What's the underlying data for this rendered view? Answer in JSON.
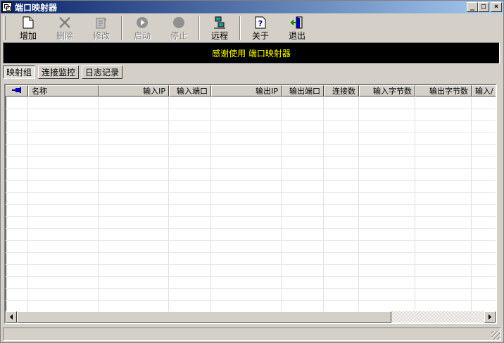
{
  "window": {
    "title": "端口映射器"
  },
  "title_buttons": {
    "minimize": "_",
    "maximize": "□",
    "close": "×"
  },
  "toolbar": {
    "add": "增加",
    "delete": "删除",
    "modify": "修改",
    "start": "启动",
    "stop": "停止",
    "remote": "远程",
    "about": "关于",
    "exit": "退出"
  },
  "banner": {
    "text": "感谢使用 端口映射器"
  },
  "tabs": [
    {
      "label": "映射组",
      "active": true
    },
    {
      "label": "连接监控",
      "active": false
    },
    {
      "label": "日志记录",
      "active": false
    }
  ],
  "list": {
    "columns": [
      "名称",
      "输入IP",
      "输入端口",
      "输出IP",
      "输出端口",
      "连接数",
      "输入字节数",
      "输出字节数",
      "输入/"
    ]
  },
  "colors": {
    "banner_bg": "#000000",
    "banner_text": "#ffff00",
    "title_start": "#0a246a",
    "title_end": "#a6caf0"
  }
}
